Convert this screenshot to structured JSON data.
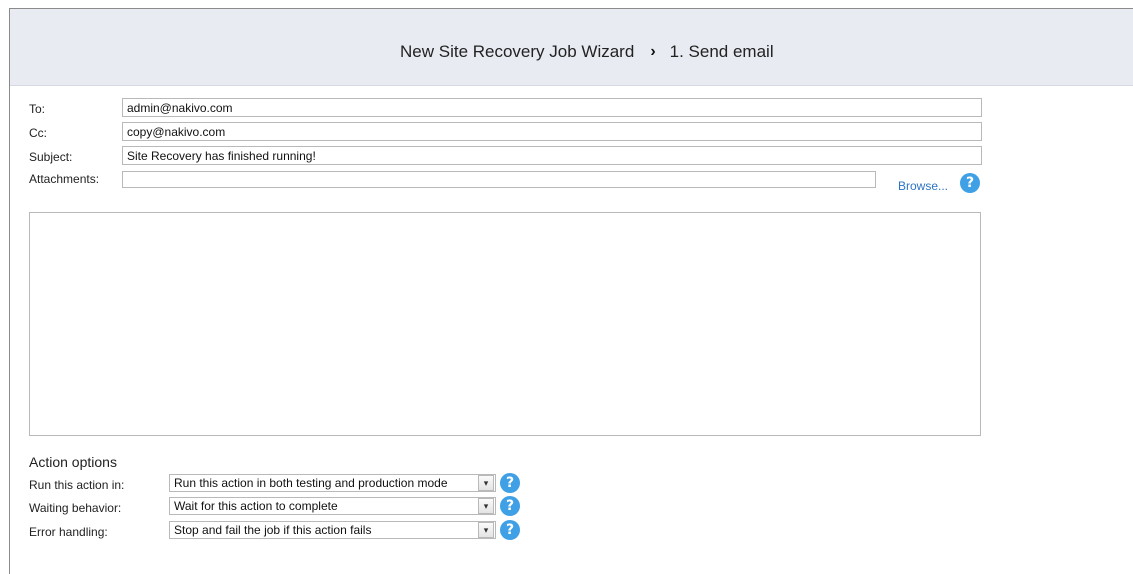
{
  "header": {
    "wizard_title": "New Site Recovery Job Wizard",
    "separator": "›",
    "step_title": "1. Send email"
  },
  "email": {
    "to_label": "To:",
    "to_value": "admin@nakivo.com",
    "cc_label": "Cc:",
    "cc_value": "copy@nakivo.com",
    "subject_label": "Subject:",
    "subject_value": "Site Recovery has finished running!",
    "attachments_label": "Attachments:",
    "attachments_value": "",
    "browse_label": "Browse...",
    "body_value": ""
  },
  "action_options": {
    "title": "Action options",
    "run_label": "Run this action in:",
    "run_value": "Run this action in both testing and production mode",
    "waiting_label": "Waiting behavior:",
    "waiting_value": "Wait for this action to complete",
    "error_label": "Error handling:",
    "error_value": "Stop and fail the job if this action fails"
  },
  "icons": {
    "help": "?",
    "dropdown": "▾"
  },
  "colors": {
    "header_bg": "#e8ebf2",
    "link": "#2d74c4",
    "help_icon": "#3fa0e6"
  }
}
